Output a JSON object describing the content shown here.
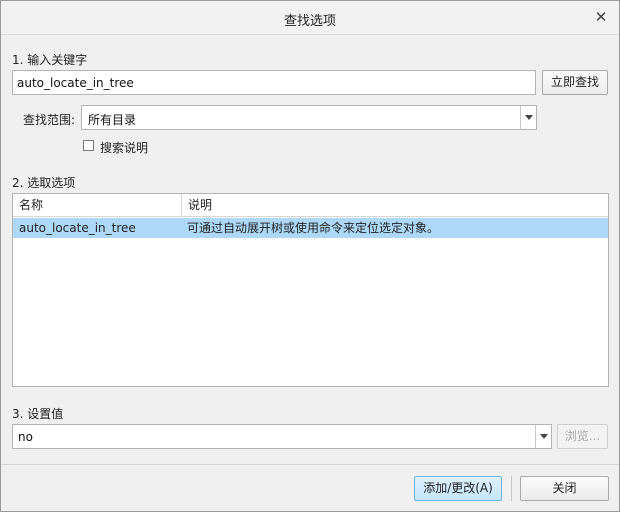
{
  "window": {
    "title": "查找选项"
  },
  "step1": {
    "label": "1.  输入关键字",
    "keyword_value": "auto_locate_in_tree",
    "find_now_label": "立即查找"
  },
  "scope": {
    "label": "查找范围:",
    "value": "所有目录"
  },
  "search_desc": {
    "label": "搜索说明",
    "checked": false
  },
  "step2": {
    "label": "2.  选取选项",
    "columns": [
      "名称",
      "说明"
    ],
    "rows": [
      {
        "name": "auto_locate_in_tree",
        "desc": "可通过自动展开树或使用命令来定位选定对象。",
        "selected": true
      }
    ]
  },
  "step3": {
    "label": "3.  设置值",
    "value": "no",
    "browse_label": "浏览..."
  },
  "footer": {
    "apply_label": "添加/更改(A)",
    "close_label": "关闭"
  },
  "colors": {
    "selection": "#add8f7",
    "primary_button": "#c6e6fb"
  }
}
